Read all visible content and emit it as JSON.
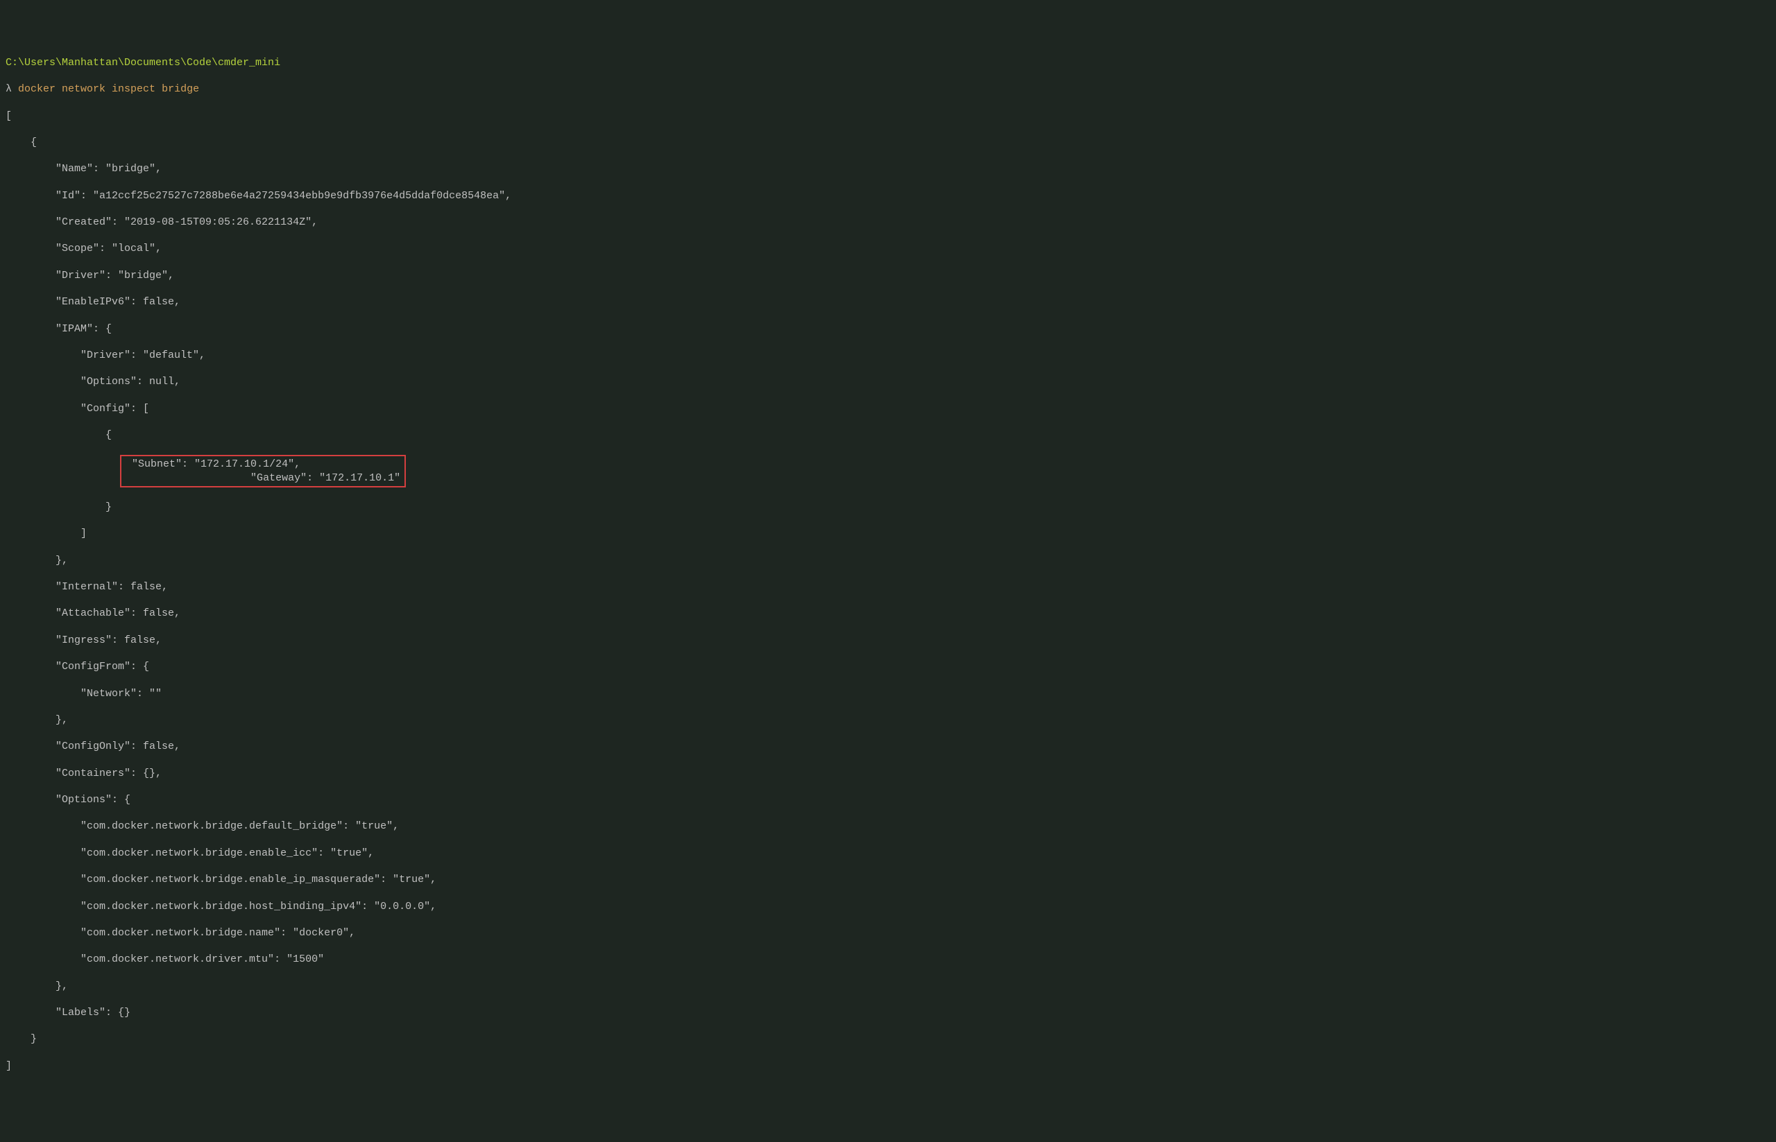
{
  "terminal": {
    "path": "C:\\Users\\Manhattan\\Documents\\Code\\cmder_mini",
    "prompt_symbol": "λ",
    "command": "docker network inspect bridge",
    "output": {
      "line_01": "[",
      "line_02": "    {",
      "line_03": "        \"Name\": \"bridge\",",
      "line_04": "        \"Id\": \"a12ccf25c27527c7288be6e4a27259434ebb9e9dfb3976e4d5ddaf0dce8548ea\",",
      "line_05": "        \"Created\": \"2019-08-15T09:05:26.6221134Z\",",
      "line_06": "        \"Scope\": \"local\",",
      "line_07": "        \"Driver\": \"bridge\",",
      "line_08": "        \"EnableIPv6\": false,",
      "line_09": "        \"IPAM\": {",
      "line_10": "            \"Driver\": \"default\",",
      "line_11": "            \"Options\": null,",
      "line_12": "            \"Config\": [",
      "line_13": "                {",
      "line_14_hl1": "                    \"Subnet\": \"172.17.10.1/24\",",
      "line_14_hl2": "                    \"Gateway\": \"172.17.10.1\"",
      "line_15": "                }",
      "line_16": "            ]",
      "line_17": "        },",
      "line_18": "        \"Internal\": false,",
      "line_19": "        \"Attachable\": false,",
      "line_20": "        \"Ingress\": false,",
      "line_21": "        \"ConfigFrom\": {",
      "line_22": "            \"Network\": \"\"",
      "line_23": "        },",
      "line_24": "        \"ConfigOnly\": false,",
      "line_25": "        \"Containers\": {},",
      "line_26": "        \"Options\": {",
      "line_27": "            \"com.docker.network.bridge.default_bridge\": \"true\",",
      "line_28": "            \"com.docker.network.bridge.enable_icc\": \"true\",",
      "line_29": "            \"com.docker.network.bridge.enable_ip_masquerade\": \"true\",",
      "line_30": "            \"com.docker.network.bridge.host_binding_ipv4\": \"0.0.0.0\",",
      "line_31": "            \"com.docker.network.bridge.name\": \"docker0\",",
      "line_32": "            \"com.docker.network.driver.mtu\": \"1500\"",
      "line_33": "        },",
      "line_34": "        \"Labels\": {}",
      "line_35": "    }",
      "line_36": "]"
    }
  }
}
